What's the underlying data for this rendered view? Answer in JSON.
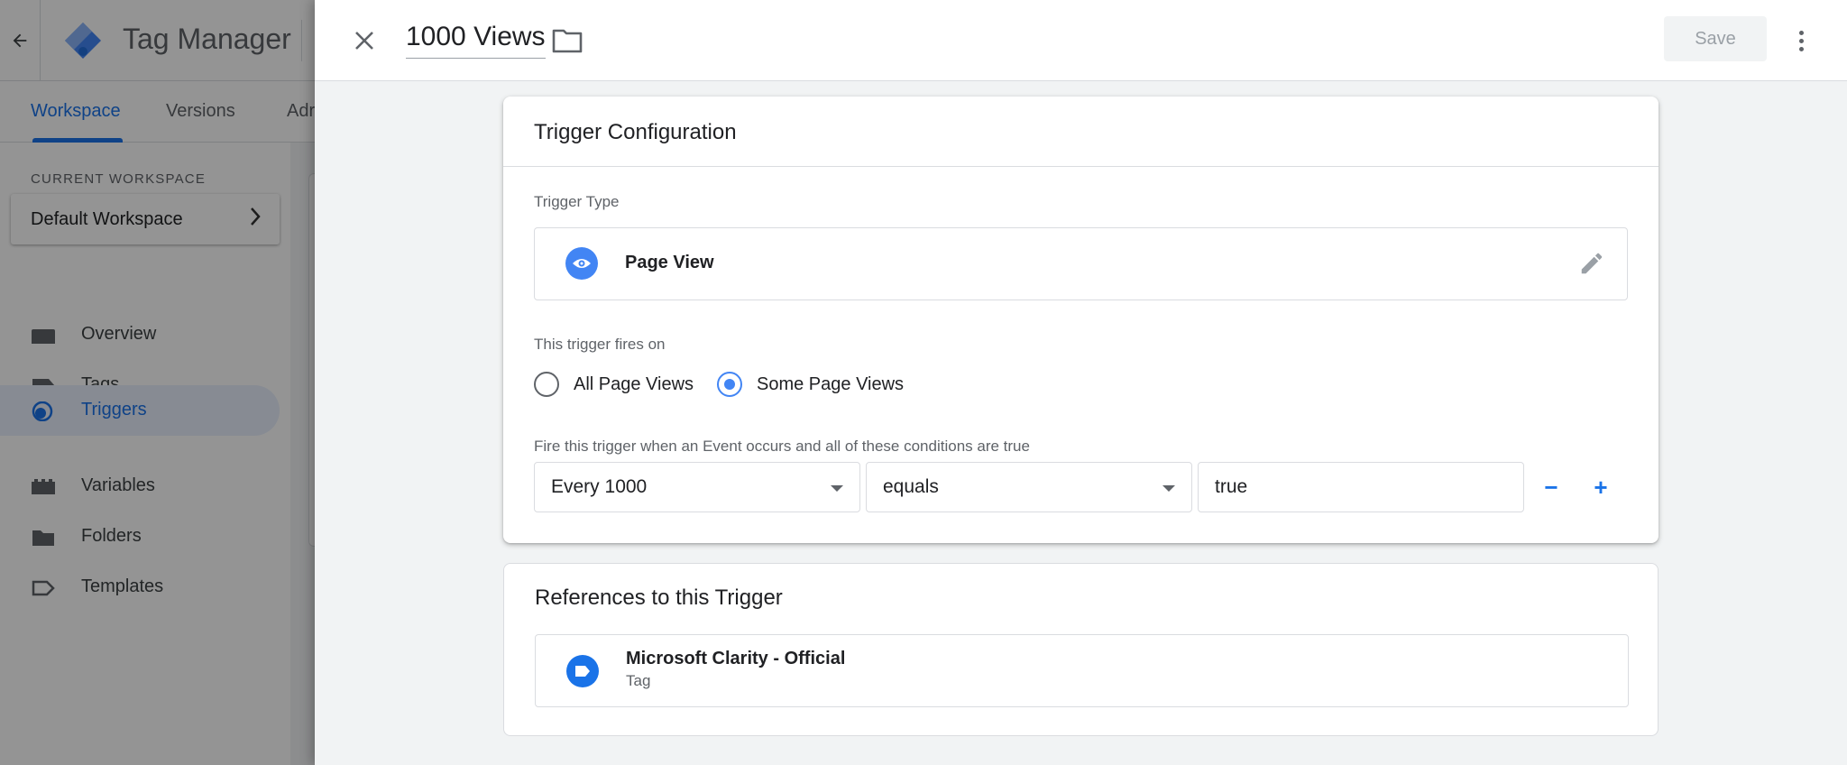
{
  "app": {
    "title": "Tag Manager",
    "tabs": [
      {
        "label": "Workspace",
        "active": true
      },
      {
        "label": "Versions",
        "active": false
      },
      {
        "label": "Adr",
        "active": false
      }
    ],
    "sidebar": {
      "workspace_label": "CURRENT WORKSPACE",
      "workspace_name": "Default Workspace",
      "items": [
        {
          "label": "Overview",
          "icon": "overview-icon"
        },
        {
          "label": "Tags",
          "icon": "tag-icon"
        },
        {
          "label": "Triggers",
          "icon": "trigger-icon",
          "active": true
        },
        {
          "label": "Variables",
          "icon": "variables-icon"
        },
        {
          "label": "Folders",
          "icon": "folder-icon"
        },
        {
          "label": "Templates",
          "icon": "template-icon"
        }
      ]
    }
  },
  "panel": {
    "title": "1000 Views",
    "save_label": "Save",
    "config": {
      "title": "Trigger Configuration",
      "type_label": "Trigger Type",
      "type_name": "Page View",
      "fires_on_label": "This trigger fires on",
      "options": [
        {
          "label": "All Page Views",
          "checked": false
        },
        {
          "label": "Some Page Views",
          "checked": true
        }
      ],
      "condition_label": "Fire this trigger when an Event occurs and all of these conditions are true",
      "condition": {
        "variable": "Every 1000",
        "operator": "equals",
        "value": "true"
      },
      "remove_label": "−",
      "add_label": "+"
    },
    "references": {
      "title": "References to this Trigger",
      "items": [
        {
          "name": "Microsoft Clarity - Official",
          "type": "Tag"
        }
      ]
    }
  },
  "colors": {
    "accent": "#1a73e8",
    "icon_blue": "#4285f4",
    "scrim": "rgba(0,0,0,0.42)"
  }
}
